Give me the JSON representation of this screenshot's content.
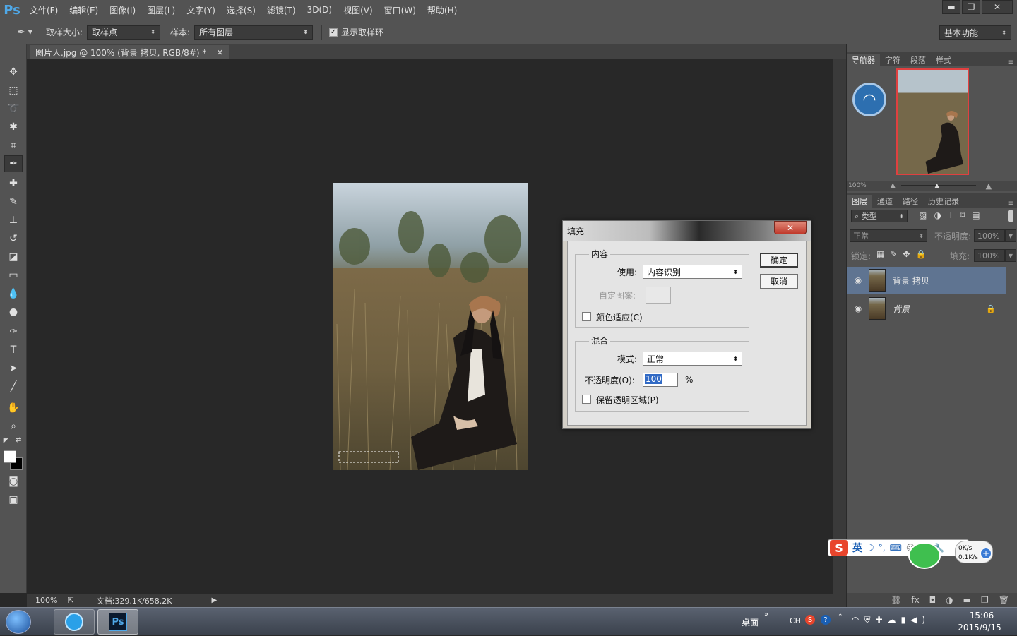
{
  "app": {
    "logo": "Ps"
  },
  "menu": [
    "文件(F)",
    "编辑(E)",
    "图像(I)",
    "图层(L)",
    "文字(Y)",
    "选择(S)",
    "滤镜(T)",
    "3D(D)",
    "视图(V)",
    "窗口(W)",
    "帮助(H)"
  ],
  "window_controls": {
    "minimize": "▬",
    "restore": "❐",
    "close": "✕"
  },
  "options": {
    "sample_size_label": "取样大小:",
    "sample_size_value": "取样点",
    "sample_label": "样本:",
    "sample_value": "所有图层",
    "show_ring_label": "显示取样环",
    "workspace": "基本功能"
  },
  "document": {
    "tab_title": "图片人.jpg @ 100% (背景 拷贝, RGB/8#) *",
    "tab_close": "×",
    "zoom": "100%",
    "doc_info": "文档:329.1K/658.2K"
  },
  "panels": {
    "top_tabs": [
      "导航器",
      "字符",
      "段落",
      "样式"
    ],
    "nav_zoom": "100%",
    "layer_tabs": [
      "图层",
      "通道",
      "路径",
      "历史记录"
    ],
    "filter_label": "类型",
    "blend_mode": "正常",
    "opacity_label": "不透明度:",
    "opacity_value": "100%",
    "lock_label": "锁定:",
    "fill_label": "填充:",
    "fill_value": "100%",
    "layers": [
      {
        "name": "背景 拷贝"
      },
      {
        "name": "背景"
      }
    ]
  },
  "dialog": {
    "title": "填充",
    "close": "✕",
    "content_group": "内容",
    "use_label": "使用:",
    "use_value": "内容识别",
    "custom_pattern_label": "自定图案:",
    "color_adapt_label": "颜色适应(C)",
    "blend_group": "混合",
    "mode_label": "模式:",
    "mode_value": "正常",
    "opacity_label": "不透明度(O):",
    "opacity_value": "100",
    "percent": "%",
    "preserve_label": "保留透明区域(P)",
    "ok": "确定",
    "cancel": "取消"
  },
  "ime": {
    "lang": "英",
    "up": "0K/s",
    "down": "0.1K/s"
  },
  "taskbar": {
    "desktop": "桌面",
    "ch": "CH",
    "time": "15:06",
    "date": "2015/9/15",
    "ps": "Ps"
  },
  "colors": {
    "accent": "#4fa8e8",
    "panel": "#535353",
    "canvas": "#282828",
    "selected_layer": "#5f7491"
  }
}
